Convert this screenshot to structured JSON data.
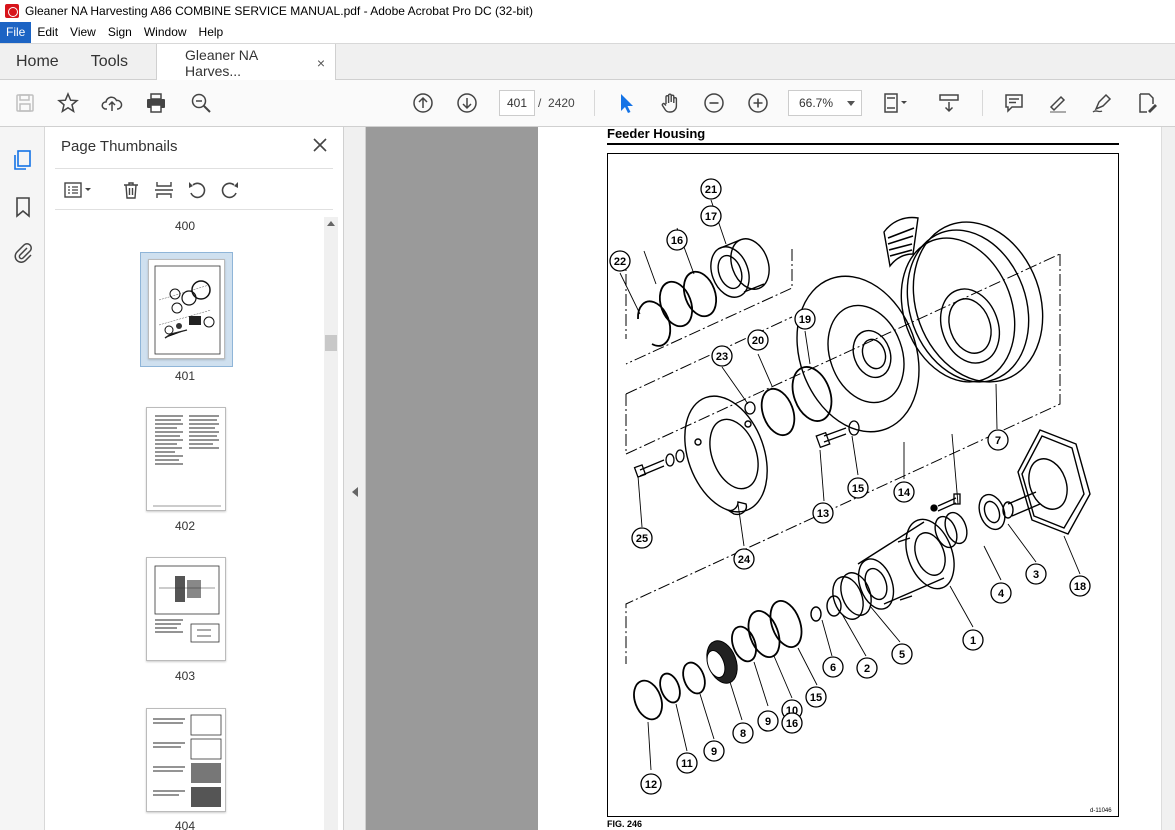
{
  "window": {
    "title": "Gleaner NA Harvesting A86 COMBINE SERVICE MANUAL.pdf - Adobe Acrobat Pro DC (32-bit)"
  },
  "menu": {
    "items": [
      "File",
      "Edit",
      "View",
      "Sign",
      "Window",
      "Help"
    ]
  },
  "tabs": {
    "home": "Home",
    "tools": "Tools",
    "document": "Gleaner NA Harves...",
    "close_glyph": "×"
  },
  "toolbar": {
    "current_page": "401",
    "page_separator": "/",
    "total_pages": "2420",
    "zoom": "66.7%"
  },
  "sidebar": {
    "title": "Page Thumbnails",
    "thumbnails": [
      {
        "label": "400"
      },
      {
        "label": "401",
        "selected": true
      },
      {
        "label": "402"
      },
      {
        "label": "403"
      },
      {
        "label": "404"
      }
    ]
  },
  "document": {
    "section_title": "Feeder Housing",
    "figure_label": "FIG. 246",
    "figure_id": "d-11046",
    "callouts": [
      "1",
      "2",
      "3",
      "4",
      "5",
      "6",
      "7",
      "8",
      "9",
      "9",
      "10",
      "11",
      "12",
      "13",
      "14",
      "15",
      "15",
      "16",
      "16",
      "17",
      "18",
      "19",
      "20",
      "21",
      "22",
      "23",
      "24",
      "25"
    ]
  },
  "colors": {
    "menu_active": "#1c64c4",
    "select_tool": "#1473e6",
    "app_icon": "#d7141b"
  }
}
